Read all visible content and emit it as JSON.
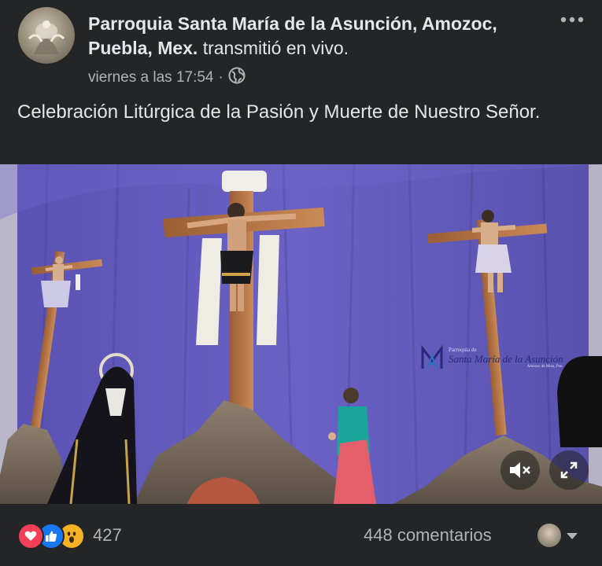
{
  "header": {
    "author_name": "Parroquia Santa María de la Asunción, Amozoc, Puebla, Mex.",
    "author_action": "transmitió en vivo.",
    "timestamp": "viernes a las 17:54",
    "separator": "·",
    "audience_icon": "globe-icon",
    "more_icon": "more-options-icon"
  },
  "post": {
    "caption": "Celebración Litúrgica de la Pasión y Muerte de Nuestro Señor."
  },
  "video": {
    "watermark_line1": "Parroquia de",
    "watermark_line2": "Santa María de la Asunción",
    "watermark_line3": "Amozoc de Mota, Pue.",
    "mute_icon": "speaker-muted-icon",
    "fullscreen_icon": "fullscreen-icon"
  },
  "footer": {
    "reaction_icons": [
      "love-icon",
      "like-icon",
      "wow-icon"
    ],
    "reaction_count": "427",
    "comment_count": "448 comentarios",
    "caret_icon": "caret-down-icon"
  },
  "colors": {
    "background": "#242526",
    "text_primary": "#e4e6eb",
    "text_secondary": "#b0b3b8",
    "like_blue": "#1877f2",
    "love_red": "#f33e58",
    "wow_yellow": "#f7b125",
    "curtain_purple": "#5f58b6"
  }
}
